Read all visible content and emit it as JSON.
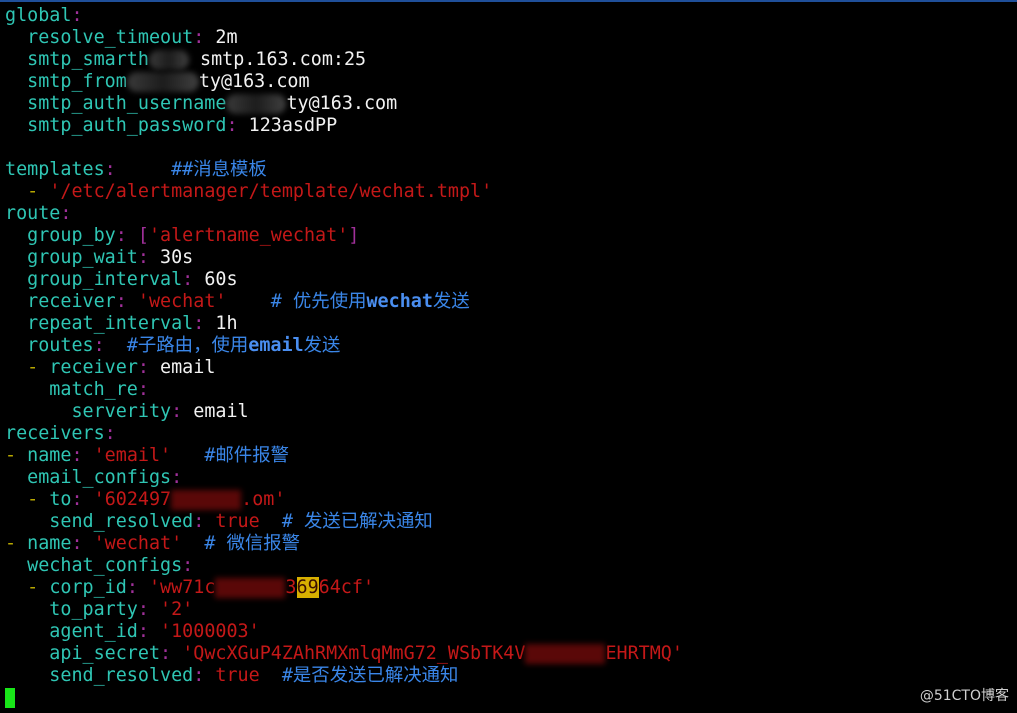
{
  "colors": {
    "key": "#2fc6b4",
    "punct": "#a0309a",
    "dash": "#b8a800",
    "string": "#c41818",
    "comment": "#3a86e8",
    "value": "#f2f2f2",
    "cursor": "#19e619",
    "highlight": "#d8b000"
  },
  "lines": [
    [
      [
        "global",
        "k"
      ],
      [
        ":",
        "p"
      ]
    ],
    [
      [
        "  "
      ],
      [
        "resolve_timeout",
        "k"
      ],
      [
        ":",
        "p"
      ],
      [
        " 2m",
        "v"
      ]
    ],
    [
      [
        "  "
      ],
      [
        "smtp_smarth",
        "k"
      ],
      [
        "#blur",
        "g",
        40
      ],
      [
        " smtp.163.com:25",
        "v"
      ]
    ],
    [
      [
        "  "
      ],
      [
        "smtp_from",
        "k"
      ],
      [
        "#blur",
        "g",
        72
      ],
      [
        "ty@163.com",
        "v"
      ]
    ],
    [
      [
        "  "
      ],
      [
        "smtp_auth_username",
        "k"
      ],
      [
        "#blur",
        "g",
        60
      ],
      [
        "ty@163.com",
        "v"
      ]
    ],
    [
      [
        "  "
      ],
      [
        "smtp_auth_password",
        "k"
      ],
      [
        ":",
        "p"
      ],
      [
        " 123asdPP",
        "v"
      ]
    ],
    [],
    [
      [
        "templates",
        "k"
      ],
      [
        ":",
        "p"
      ],
      [
        "     "
      ],
      [
        "##消息模板",
        "c"
      ]
    ],
    [
      [
        "  "
      ],
      [
        "-",
        "d"
      ],
      [
        " "
      ],
      [
        "'/etc/alertmanager/template/wechat.tmpl'",
        "s"
      ]
    ],
    [
      [
        "route",
        "k"
      ],
      [
        ":",
        "p"
      ]
    ],
    [
      [
        "  "
      ],
      [
        "group_by",
        "k"
      ],
      [
        ":",
        "p"
      ],
      [
        " "
      ],
      [
        "[",
        "p"
      ],
      [
        "'alertname_wechat'",
        "s"
      ],
      [
        "]",
        "p"
      ]
    ],
    [
      [
        "  "
      ],
      [
        "group_wait",
        "k"
      ],
      [
        ":",
        "p"
      ],
      [
        " 30s",
        "v"
      ]
    ],
    [
      [
        "  "
      ],
      [
        "group_interval",
        "k"
      ],
      [
        ":",
        "p"
      ],
      [
        " 60s",
        "v"
      ]
    ],
    [
      [
        "  "
      ],
      [
        "receiver",
        "k"
      ],
      [
        ":",
        "p"
      ],
      [
        " "
      ],
      [
        "'wechat'",
        "s"
      ],
      [
        "    "
      ],
      [
        "# 优先使用",
        "c"
      ],
      [
        "wechat",
        "cb"
      ],
      [
        "发送",
        "c"
      ]
    ],
    [
      [
        "  "
      ],
      [
        "repeat_interval",
        "k"
      ],
      [
        ":",
        "p"
      ],
      [
        " 1h",
        "v"
      ]
    ],
    [
      [
        "  "
      ],
      [
        "routes",
        "k"
      ],
      [
        ":",
        "p"
      ],
      [
        "  "
      ],
      [
        "#子路由，使用",
        "c"
      ],
      [
        "email",
        "cb"
      ],
      [
        "发送",
        "c"
      ]
    ],
    [
      [
        "  "
      ],
      [
        "-",
        "d"
      ],
      [
        " "
      ],
      [
        "receiver",
        "k"
      ],
      [
        ":",
        "p"
      ],
      [
        " email",
        "v"
      ]
    ],
    [
      [
        "    "
      ],
      [
        "match_re",
        "k"
      ],
      [
        ":",
        "p"
      ]
    ],
    [
      [
        "      "
      ],
      [
        "serverity",
        "k"
      ],
      [
        ":",
        "p"
      ],
      [
        " email",
        "v"
      ]
    ],
    [
      [
        "receivers",
        "k"
      ],
      [
        ":",
        "p"
      ]
    ],
    [
      [
        "-",
        "d"
      ],
      [
        " "
      ],
      [
        "name",
        "k"
      ],
      [
        ":",
        "p"
      ],
      [
        " "
      ],
      [
        "'email'",
        "s"
      ],
      [
        "   "
      ],
      [
        "#邮件报警",
        "c"
      ]
    ],
    [
      [
        "  "
      ],
      [
        "email_configs",
        "k"
      ],
      [
        ":",
        "p"
      ]
    ],
    [
      [
        "  "
      ],
      [
        "-",
        "d"
      ],
      [
        " "
      ],
      [
        "to",
        "k"
      ],
      [
        ":",
        "p"
      ],
      [
        " "
      ],
      [
        "'602497",
        "s"
      ],
      [
        "#blur",
        "r",
        70
      ],
      [
        ".om'",
        "s"
      ]
    ],
    [
      [
        "    "
      ],
      [
        "send_resolved",
        "k"
      ],
      [
        ":",
        "p"
      ],
      [
        " "
      ],
      [
        "true",
        "s"
      ],
      [
        "  "
      ],
      [
        "# 发送已解决通知",
        "c"
      ]
    ],
    [
      [
        "-",
        "d"
      ],
      [
        " "
      ],
      [
        "name",
        "k"
      ],
      [
        ":",
        "p"
      ],
      [
        " "
      ],
      [
        "'wechat'",
        "s"
      ],
      [
        "  "
      ],
      [
        "# 微信报警",
        "c"
      ]
    ],
    [
      [
        "  "
      ],
      [
        "wechat_configs",
        "k"
      ],
      [
        ":",
        "p"
      ]
    ],
    [
      [
        "  "
      ],
      [
        "-",
        "d"
      ],
      [
        " "
      ],
      [
        "corp_id",
        "k"
      ],
      [
        ":",
        "p"
      ],
      [
        " "
      ],
      [
        "'ww71c",
        "s"
      ],
      [
        "#blur",
        "r",
        70
      ],
      [
        "3",
        "s"
      ],
      [
        "69",
        "hl"
      ],
      [
        "64cf'",
        "s"
      ]
    ],
    [
      [
        "    "
      ],
      [
        "to_party",
        "k"
      ],
      [
        ":",
        "p"
      ],
      [
        " "
      ],
      [
        "'2'",
        "s"
      ]
    ],
    [
      [
        "    "
      ],
      [
        "agent_id",
        "k"
      ],
      [
        ":",
        "p"
      ],
      [
        " "
      ],
      [
        "'1000003'",
        "s"
      ]
    ],
    [
      [
        "    "
      ],
      [
        "api_secret",
        "k"
      ],
      [
        ":",
        "p"
      ],
      [
        " "
      ],
      [
        "'QwcXGuP4ZAhRMXmlqMmG72_WSbTK4V",
        "s"
      ],
      [
        "#blur",
        "r",
        80
      ],
      [
        "EHRTMQ'",
        "s"
      ]
    ],
    [
      [
        "    "
      ],
      [
        "send_resolved",
        "k"
      ],
      [
        ":",
        "p"
      ],
      [
        " "
      ],
      [
        "true",
        "s"
      ],
      [
        "  "
      ],
      [
        "#是否发送已解决通知",
        "c"
      ]
    ]
  ],
  "watermark": "@51CTO博客"
}
